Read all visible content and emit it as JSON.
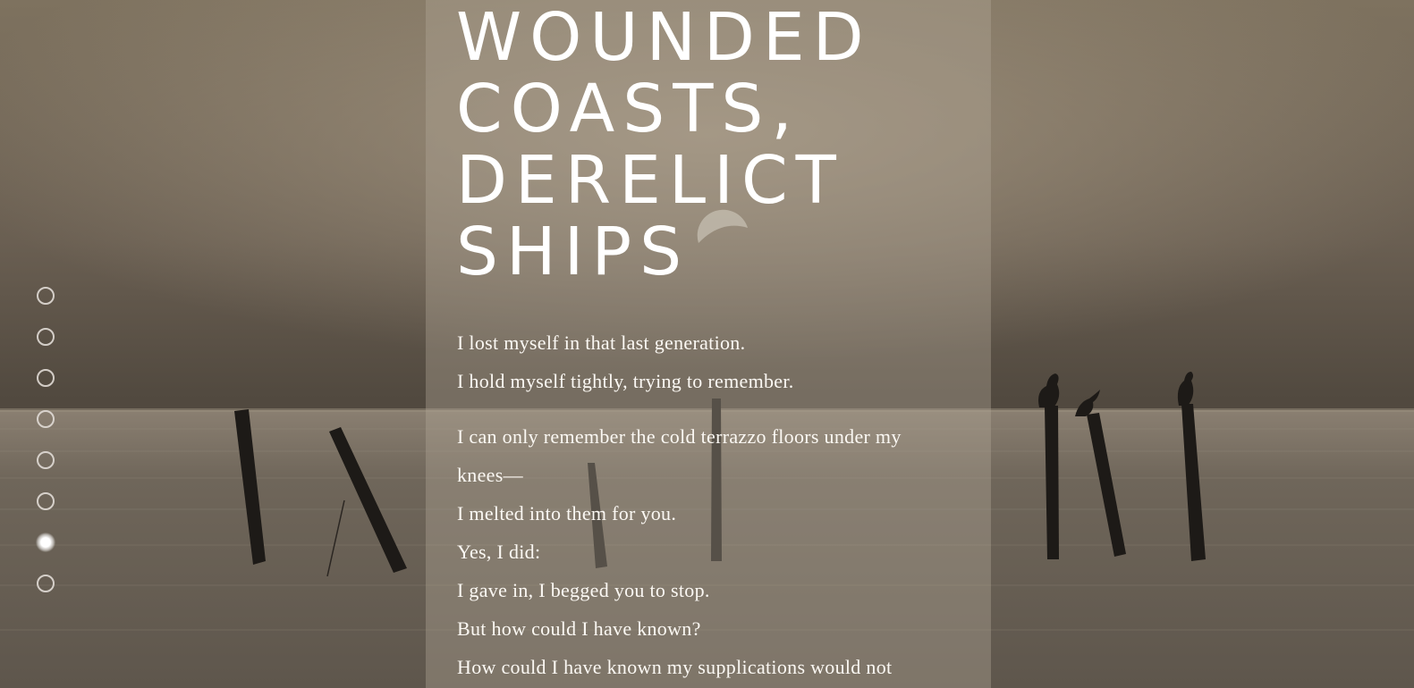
{
  "page": {
    "title_lines": [
      "WOUNDED",
      "COASTS,",
      "DERELICT",
      "SHIPS"
    ],
    "poem_lines": [
      "I lost myself in that last generation.",
      "I hold myself tightly, trying to remember.",
      "I can only remember the cold terrazzo floors under my knees—",
      "I melted into them for you.",
      "Yes, I did:",
      "I gave in, I begged you to stop.",
      "But how could I have known?",
      "How could I have known my supplications would not"
    ]
  },
  "nav": {
    "dots": [
      {
        "name": "section-1",
        "active": false
      },
      {
        "name": "section-2",
        "active": false
      },
      {
        "name": "section-3",
        "active": false
      },
      {
        "name": "section-4",
        "active": false
      },
      {
        "name": "section-5",
        "active": false
      },
      {
        "name": "section-6",
        "active": false
      },
      {
        "name": "section-7",
        "active": true
      },
      {
        "name": "section-8",
        "active": false
      }
    ]
  },
  "colors": {
    "sky_top": "#8b7d6b",
    "sky_horizon": "#4e463d",
    "water": "#6f665c",
    "panel": "#b4a898",
    "text": "#ffffff",
    "post": "#1d1a17"
  },
  "background": {
    "subject": "sepia seascape with wooden pilings and perched pelicans at dusk"
  }
}
